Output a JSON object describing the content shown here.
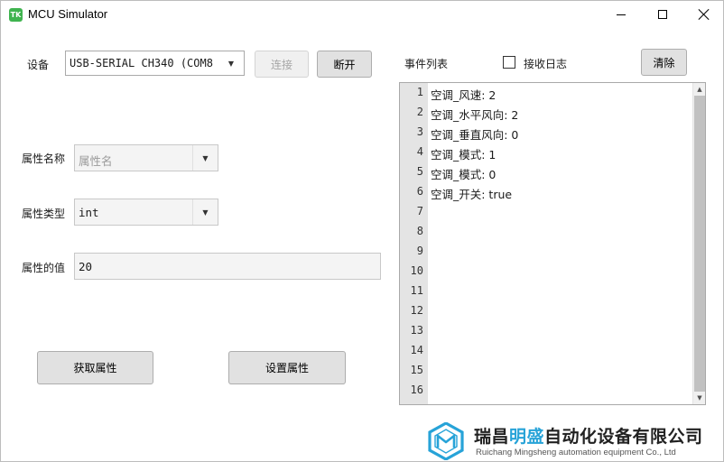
{
  "window": {
    "title": "MCU Simulator",
    "icon_text": "TK",
    "icon_color": "#3fb34f"
  },
  "device": {
    "label": "设备",
    "selected": "USB-SERIAL CH340 (COM8",
    "connect_label": "连接",
    "connect_disabled": true,
    "disconnect_label": "断开"
  },
  "property": {
    "name_label": "属性名称",
    "name_placeholder": "属性名",
    "type_label": "属性类型",
    "type_selected": "int",
    "value_label": "属性的值",
    "value": "20"
  },
  "actions": {
    "get_label": "获取属性",
    "set_label": "设置属性"
  },
  "events": {
    "title": "事件列表",
    "receive_log_label": "接收日志",
    "receive_log_checked": false,
    "clear_label": "清除",
    "line_numbers": [
      "1",
      "2",
      "3",
      "4",
      "5",
      "6",
      "7",
      "8",
      "9",
      "10",
      "11",
      "12",
      "13",
      "14",
      "15",
      "16"
    ],
    "lines": [
      "空调_风速: 2",
      "空调_水平风向: 2",
      "空调_垂直风向: 0",
      "空调_模式: 1",
      "空调_模式: 0",
      "空调_开关: true"
    ]
  },
  "watermark": {
    "company_cn_part1": "瑞昌",
    "company_cn_accent": "明盛",
    "company_cn_part2": "自动化设备有限公司",
    "company_en": "Ruichang Mingsheng automation equipment Co., Ltd",
    "accent_color": "#27a3d8"
  }
}
